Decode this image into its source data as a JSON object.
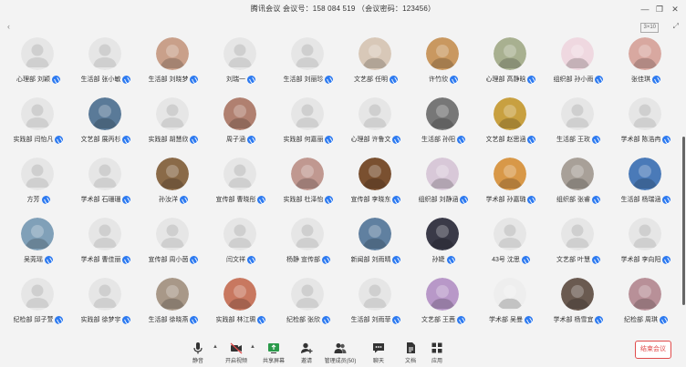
{
  "window": {
    "title": "腾讯会议 会议号：158 084 519 （会议密码：123456）",
    "minimize_glyph": "—",
    "restore_glyph": "❐",
    "close_glyph": "✕"
  },
  "subbar": {
    "left_icon": "‹",
    "view_label": "3×10",
    "right_icon": "⤢"
  },
  "participants": [
    {
      "name": "心理部 刘颖",
      "avatar": "default"
    },
    {
      "name": "生活部 张小敏",
      "avatar": "default"
    },
    {
      "name": "生活部 刘晓梦",
      "avatar": "photo",
      "color": "#c9a08a"
    },
    {
      "name": "刘瑞一",
      "avatar": "default"
    },
    {
      "name": "生活部 刘丽珍",
      "avatar": "default"
    },
    {
      "name": "文艺部 任明",
      "avatar": "photo",
      "color": "#d8c8b8"
    },
    {
      "name": "许竹欣",
      "avatar": "photo",
      "color": "#c99860"
    },
    {
      "name": "心理部 高静晗",
      "avatar": "photo",
      "color": "#a8b090"
    },
    {
      "name": "组织部 孙小雨",
      "avatar": "photo",
      "color": "#efd8e0"
    },
    {
      "name": "张佳琪",
      "avatar": "photo",
      "color": "#d8a8a0"
    },
    {
      "name": "实践部 闫怡凡",
      "avatar": "default"
    },
    {
      "name": "文艺部 展丙杉",
      "avatar": "photo",
      "color": "#5a7a98"
    },
    {
      "name": "实践部 胡慧欣",
      "avatar": "default"
    },
    {
      "name": "周子涵",
      "avatar": "photo",
      "color": "#b08070"
    },
    {
      "name": "实践部 何嘉丽",
      "avatar": "default"
    },
    {
      "name": "心理部 许鲁文",
      "avatar": "default"
    },
    {
      "name": "生活部 孙阳",
      "avatar": "photo",
      "color": "#777777"
    },
    {
      "name": "文艺部 赵思涵",
      "avatar": "photo",
      "color": "#c8a040"
    },
    {
      "name": "生活部 王玫",
      "avatar": "default"
    },
    {
      "name": "学术部 陈浩冉",
      "avatar": "default"
    },
    {
      "name": "方芳",
      "avatar": "default"
    },
    {
      "name": "学术部 石珊珊",
      "avatar": "default"
    },
    {
      "name": "孙汝洋",
      "avatar": "photo",
      "color": "#8a6a48"
    },
    {
      "name": "宣传部 曹晓彤",
      "avatar": "default"
    },
    {
      "name": "实践部 杜泽怡",
      "avatar": "photo",
      "color": "#c09890"
    },
    {
      "name": "宣传部 李晓东",
      "avatar": "photo",
      "color": "#7a5030"
    },
    {
      "name": "组织部 刘静涵",
      "avatar": "photo",
      "color": "#d8c8d8"
    },
    {
      "name": "学术部 孙嘉璐",
      "avatar": "photo",
      "color": "#d89848"
    },
    {
      "name": "组织部 张睿",
      "avatar": "photo",
      "color": "#a8a098"
    },
    {
      "name": "生活部 杨瑞涵",
      "avatar": "photo",
      "color": "#4a7ab8"
    },
    {
      "name": "吴莞瑶",
      "avatar": "photo",
      "color": "#80a0b8"
    },
    {
      "name": "学术部 曹佳丽",
      "avatar": "default"
    },
    {
      "name": "宣传部 周小茵",
      "avatar": "default"
    },
    {
      "name": "闫文祥",
      "avatar": "default"
    },
    {
      "name": "杨静 宣传部",
      "avatar": "default"
    },
    {
      "name": "新闻部 刘雨晴",
      "avatar": "photo",
      "color": "#6080a0"
    },
    {
      "name": "孙婕",
      "avatar": "photo",
      "color": "#3a3a48"
    },
    {
      "name": "43号 沈思",
      "avatar": "default"
    },
    {
      "name": "文艺部 叶慧",
      "avatar": "default"
    },
    {
      "name": "学术部 李向阳",
      "avatar": "default"
    },
    {
      "name": "纪检部 邱子萱",
      "avatar": "default"
    },
    {
      "name": "实践部 徐梦宇",
      "avatar": "default"
    },
    {
      "name": "生活部 徐晓燕",
      "avatar": "photo",
      "color": "#a89888"
    },
    {
      "name": "实践部 林江珮",
      "avatar": "photo",
      "color": "#c87860"
    },
    {
      "name": "纪检部 张欣",
      "avatar": "default"
    },
    {
      "name": "生活部 刘雨菲",
      "avatar": "default"
    },
    {
      "name": "文艺部 王茜",
      "avatar": "photo",
      "color": "#b898c8"
    },
    {
      "name": "学术部 吴曼",
      "avatar": "photo",
      "color": "#eeeeee"
    },
    {
      "name": "学术部 杨雪宜",
      "avatar": "photo",
      "color": "#6a5a50"
    },
    {
      "name": "纪检部 周琪",
      "avatar": "photo",
      "color": "#b89098"
    }
  ],
  "toolbar": {
    "mute": "静音",
    "stop_video": "开启视频",
    "share_screen": "共享屏幕",
    "invite": "邀请",
    "participants": "管理成员(50)",
    "chat": "聊天",
    "docs": "文档",
    "apps": "应用",
    "leave": "结束会议"
  },
  "colors": {
    "accent": "#2d7af0",
    "leave_red": "#e04b4b",
    "background": "#f3f3f3"
  }
}
